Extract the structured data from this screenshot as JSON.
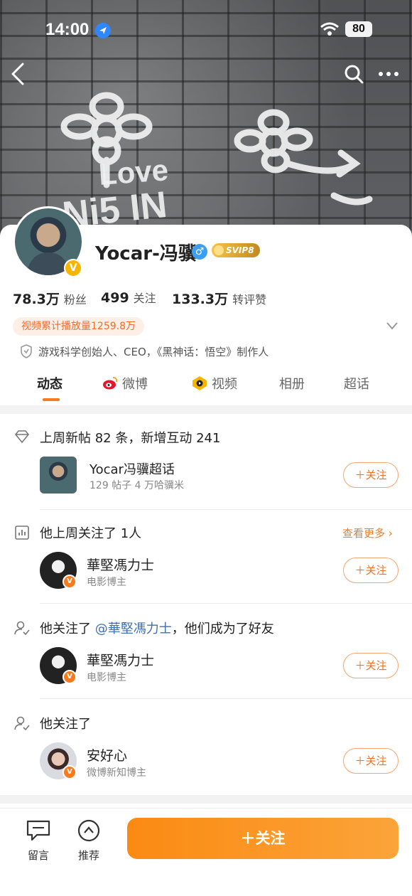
{
  "status_bar": {
    "time": "14:00",
    "battery": "80"
  },
  "profile": {
    "name": "Yocar-冯骥",
    "gender_symbol": "♂",
    "svip_label": "SVIP8",
    "verified_symbol": "V",
    "stats": [
      {
        "num": "78.3万",
        "label": "粉丝"
      },
      {
        "num": "499",
        "label": "关注"
      },
      {
        "num": "133.3万",
        "label": "转评赞"
      }
    ],
    "play_count": "视频累计播放量1259.8万",
    "intro": "游戏科学创始人、CEO，《黑神话：悟空》制作人"
  },
  "tabs": [
    {
      "label": "动态",
      "active": true
    },
    {
      "label": "微博"
    },
    {
      "label": "视频"
    },
    {
      "label": "相册"
    },
    {
      "label": "超话"
    }
  ],
  "feed": {
    "weekly": {
      "title": "上周新帖 82 条，新增互动 241",
      "item_name": "Yocar冯骥超话",
      "item_sub": "129 帖子 4 万哈骥米",
      "follow_label": "＋关注"
    },
    "followed_last_week": {
      "title": "他上周关注了 1人",
      "see_more": "查看更多",
      "user_name": "華堅馮力士",
      "user_sub": "电影博主",
      "follow_label": "＋关注"
    },
    "became_friends": {
      "title_prefix": "他关注了 ",
      "mention": "@華堅馮力士",
      "title_suffix": "，他们成为了好友",
      "user_name": "華堅馮力士",
      "user_sub": "电影博主",
      "follow_label": "＋关注"
    },
    "followed": {
      "title": "他关注了",
      "user_name": "安好心",
      "user_sub": "微博新知博主",
      "follow_label": "＋关注"
    }
  },
  "bottom_bar": {
    "message_label": "留言",
    "recommend_label": "推荐",
    "follow_label": "＋关注"
  },
  "colors": {
    "accent": "#f77b1d",
    "mention": "#3c6fb6"
  }
}
